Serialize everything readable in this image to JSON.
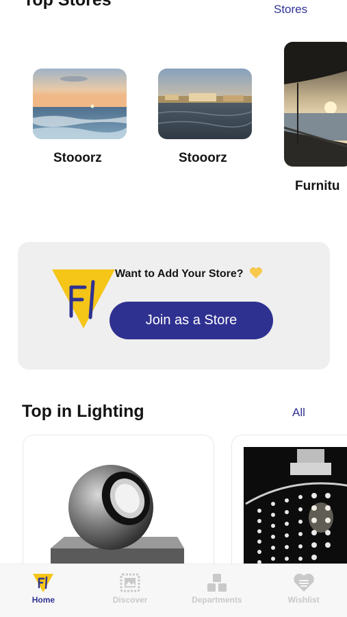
{
  "top_stores": {
    "title": "Top Stores",
    "see_all": "Stores",
    "items": [
      {
        "name": "Stooorz",
        "image": "sunset-sea"
      },
      {
        "name": "Stooorz",
        "image": "harbor"
      },
      {
        "name": "Furnitu",
        "image": "deck-sunset"
      }
    ]
  },
  "promo": {
    "text": "Want to Add Your Store?",
    "emoji": "yellow-heart",
    "button_label": "Join as a Store"
  },
  "lighting": {
    "title": "Top in Lighting",
    "see_all": "All",
    "products": [
      {
        "image": "spot-lamp"
      },
      {
        "image": "crystal-chandelier"
      }
    ]
  },
  "nav": {
    "items": [
      {
        "label": "Home",
        "icon": "home-logo-icon",
        "active": true
      },
      {
        "label": "Discover",
        "icon": "stamp-icon",
        "active": false
      },
      {
        "label": "Departments",
        "icon": "blocks-icon",
        "active": false
      },
      {
        "label": "Wishlist",
        "icon": "heart-list-icon",
        "active": false
      }
    ]
  },
  "colors": {
    "brand": "#2f3191",
    "accent": "#f5c518",
    "inactive": "#c9c9c9"
  }
}
